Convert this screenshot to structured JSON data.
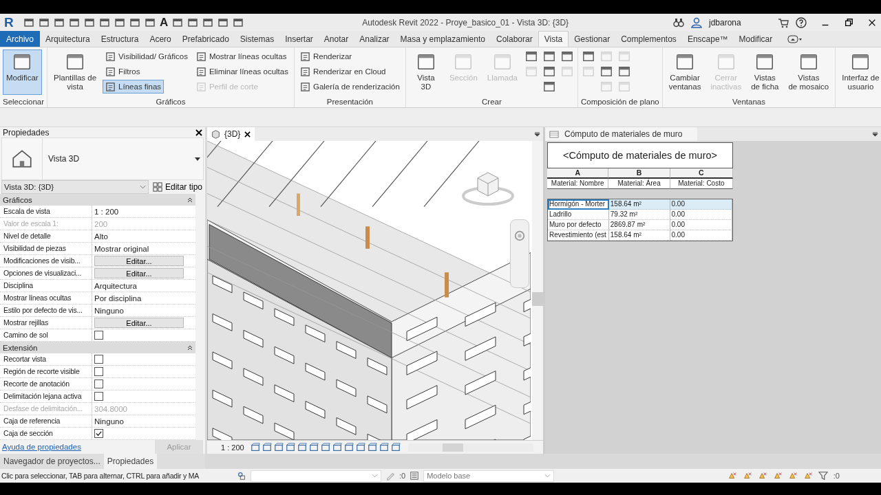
{
  "app_logo": "R",
  "qat_text_tool": "A",
  "window": {
    "title": "Autodesk Revit 2022 - Proye_basico_01 - Vista 3D: {3D}",
    "user": "jdbarona"
  },
  "ribbon_tabs": [
    {
      "label": "Archivo",
      "kind": "file",
      "selected": false
    },
    {
      "label": "Arquitectura",
      "kind": "tab",
      "selected": false
    },
    {
      "label": "Estructura",
      "kind": "tab",
      "selected": false
    },
    {
      "label": "Acero",
      "kind": "tab",
      "selected": false
    },
    {
      "label": "Prefabricado",
      "kind": "tab",
      "selected": false
    },
    {
      "label": "Sistemas",
      "kind": "tab",
      "selected": false
    },
    {
      "label": "Insertar",
      "kind": "tab",
      "selected": false
    },
    {
      "label": "Anotar",
      "kind": "tab",
      "selected": false
    },
    {
      "label": "Analizar",
      "kind": "tab",
      "selected": false
    },
    {
      "label": "Masa y emplazamiento",
      "kind": "tab",
      "selected": false
    },
    {
      "label": "Colaborar",
      "kind": "tab",
      "selected": false
    },
    {
      "label": "Vista",
      "kind": "tab",
      "selected": true
    },
    {
      "label": "Gestionar",
      "kind": "tab",
      "selected": false
    },
    {
      "label": "Complementos",
      "kind": "tab",
      "selected": false
    },
    {
      "label": "Enscape™",
      "kind": "tab",
      "selected": false
    },
    {
      "label": "Modificar",
      "kind": "tab",
      "selected": false
    }
  ],
  "ribbon_panels": [
    {
      "title": "Seleccionar",
      "columns": [
        [
          {
            "kind": "large",
            "label": "Modificar",
            "selected": true,
            "disabled": false
          }
        ]
      ]
    },
    {
      "title": "Gráficos",
      "columns": [
        [
          {
            "kind": "large",
            "label": "Plantillas de\nvista",
            "selected": false,
            "disabled": false
          }
        ],
        [
          {
            "kind": "small",
            "label": "Visibilidad/ Gráficos",
            "selected": false,
            "disabled": false
          },
          {
            "kind": "small",
            "label": "Filtros",
            "selected": false,
            "disabled": false
          },
          {
            "kind": "small",
            "label": "Líneas finas",
            "selected": true,
            "disabled": false
          }
        ],
        [
          {
            "kind": "small",
            "label": "Mostrar líneas ocultas",
            "selected": false,
            "disabled": false
          },
          {
            "kind": "small",
            "label": "Eliminar líneas ocultas",
            "selected": false,
            "disabled": false
          },
          {
            "kind": "small",
            "label": "Perfil de corte",
            "selected": false,
            "disabled": true
          }
        ]
      ]
    },
    {
      "title": "Presentación",
      "columns": [
        [
          {
            "kind": "small",
            "label": "Renderizar",
            "selected": false,
            "disabled": false
          },
          {
            "kind": "small",
            "label": "Renderizar  en Cloud",
            "selected": false,
            "disabled": false
          },
          {
            "kind": "small",
            "label": "Galería de  renderización",
            "selected": false,
            "disabled": false
          }
        ]
      ]
    },
    {
      "title": "Crear",
      "columns": [
        [
          {
            "kind": "large",
            "label": "Vista\n3D",
            "selected": false,
            "disabled": false
          }
        ],
        [
          {
            "kind": "large",
            "label": "Sección",
            "selected": false,
            "disabled": true
          }
        ],
        [
          {
            "kind": "large",
            "label": "Llamada",
            "selected": false,
            "disabled": true
          }
        ],
        [
          {
            "kind": "icon",
            "selected": false,
            "disabled": false
          },
          {
            "kind": "icon",
            "selected": false,
            "disabled": true
          }
        ],
        [
          {
            "kind": "icon",
            "selected": false,
            "disabled": false
          },
          {
            "kind": "icon",
            "selected": false,
            "disabled": false
          },
          {
            "kind": "icon",
            "selected": false,
            "disabled": false
          }
        ],
        [
          {
            "kind": "icon",
            "selected": false,
            "disabled": false
          },
          {
            "kind": "icon",
            "selected": false,
            "disabled": true
          }
        ]
      ]
    },
    {
      "title": "Composición de plano",
      "columns": [
        [
          {
            "kind": "icon",
            "selected": false,
            "disabled": false
          },
          {
            "kind": "icon",
            "selected": false,
            "disabled": true
          }
        ],
        [
          {
            "kind": "icon",
            "selected": false,
            "disabled": true
          },
          {
            "kind": "icon",
            "selected": false,
            "disabled": false
          },
          {
            "kind": "icon",
            "selected": false,
            "disabled": true
          }
        ],
        [
          {
            "kind": "icon",
            "selected": false,
            "disabled": true
          },
          {
            "kind": "icon",
            "selected": false,
            "disabled": false
          },
          {
            "kind": "icon",
            "selected": false,
            "disabled": true
          }
        ]
      ]
    },
    {
      "title": "Ventanas",
      "columns": [
        [
          {
            "kind": "large",
            "label": "Cambiar\nventanas",
            "selected": false,
            "disabled": false
          }
        ],
        [
          {
            "kind": "large",
            "label": "Cerrar\ninactivas",
            "selected": false,
            "disabled": true
          }
        ],
        [
          {
            "kind": "large",
            "label": "Vistas\nde ficha",
            "selected": false,
            "disabled": false
          }
        ],
        [
          {
            "kind": "large",
            "label": "Vistas\nde mosaico",
            "selected": false,
            "disabled": false
          }
        ]
      ]
    },
    {
      "columns": [
        [
          {
            "kind": "large",
            "label": "Interfaz de\nusuario",
            "selected": false,
            "disabled": false
          }
        ]
      ]
    }
  ],
  "properties": {
    "title": "Propiedades",
    "type_name": "Vista 3D",
    "instance": "Vista 3D: {3D}",
    "edit_type": "Editar tipo",
    "groups": [
      {
        "title": "Gráficos",
        "rows": [
          {
            "label": "Escala de vista",
            "kind": "text",
            "value": "1 : 200",
            "disabled": false
          },
          {
            "label": "Valor de escala    1:",
            "kind": "text",
            "value": "200",
            "disabled": true
          },
          {
            "label": "Nivel de detalle",
            "kind": "text",
            "value": "Alto",
            "disabled": false
          },
          {
            "label": "Visibilidad de piezas",
            "kind": "text",
            "value": "Mostrar original",
            "disabled": false
          },
          {
            "label": "Modificaciones de visib...",
            "kind": "button",
            "value": "Editar...",
            "disabled": false
          },
          {
            "label": "Opciones de visualizaci...",
            "kind": "button",
            "value": "Editar...",
            "disabled": false
          },
          {
            "label": "Disciplina",
            "kind": "text",
            "value": "Arquitectura",
            "disabled": false
          },
          {
            "label": "Mostrar líneas ocultas",
            "kind": "text",
            "value": "Por disciplina",
            "disabled": false
          },
          {
            "label": "Estilo por defecto de vis...",
            "kind": "text",
            "value": "Ninguno",
            "disabled": false
          },
          {
            "label": "Mostrar rejillas",
            "kind": "button",
            "value": "Editar...",
            "disabled": false
          },
          {
            "label": "Camino de sol",
            "kind": "checkbox",
            "checked": false,
            "disabled": false
          }
        ]
      },
      {
        "title": "Extensión",
        "rows": [
          {
            "label": "Recortar vista",
            "kind": "checkbox",
            "checked": false,
            "disabled": false
          },
          {
            "label": "Región de recorte visible",
            "kind": "checkbox",
            "checked": false,
            "disabled": false
          },
          {
            "label": "Recorte de anotación",
            "kind": "checkbox",
            "checked": false,
            "disabled": false
          },
          {
            "label": "Delimitación lejana activa",
            "kind": "checkbox",
            "checked": false,
            "disabled": false
          },
          {
            "label": "Desfase de delimitación...",
            "kind": "text",
            "value": "304.8000",
            "disabled": true
          },
          {
            "label": "Caja de referencia",
            "kind": "text",
            "value": "Ninguno",
            "disabled": false
          },
          {
            "label": "Caja de sección",
            "kind": "checkbox",
            "checked": true,
            "disabled": false
          }
        ]
      }
    ],
    "help_link": "Ayuda de propiedades",
    "apply": "Aplicar"
  },
  "bottom_tabs": [
    {
      "label": "Navegador de proyectos...",
      "selected": false
    },
    {
      "label": "Propiedades",
      "selected": true
    }
  ],
  "view": {
    "tab": "{3D}",
    "scale": "1 : 200"
  },
  "schedule": {
    "tab": "Cómputo de materiales de muro",
    "title": "<Cómputo de materiales de muro>",
    "letters": [
      "A",
      "B",
      "C"
    ],
    "headers": [
      "Material: Nombre",
      "Material: Área",
      "Material: Costo"
    ],
    "rows": [
      {
        "cells": [
          "Hormigón  - Morter",
          "158.64 m²",
          "0.00"
        ],
        "selected": true
      },
      {
        "cells": [
          "Ladrillo",
          "79.32 m²",
          "0.00"
        ],
        "selected": false
      },
      {
        "cells": [
          "Muro por defecto",
          "2869.87 m²",
          "0.00"
        ],
        "selected": false
      },
      {
        "cells": [
          "Revestimiento (est",
          "158.64 m²",
          "0.00"
        ],
        "selected": false
      }
    ]
  },
  "status_bar": {
    "message": "Clic para seleccionar, TAB para alternar, CTRL para añadir y MA",
    "workset_count": ":0",
    "design_option": "Modelo base",
    "filter_count": ":0"
  }
}
